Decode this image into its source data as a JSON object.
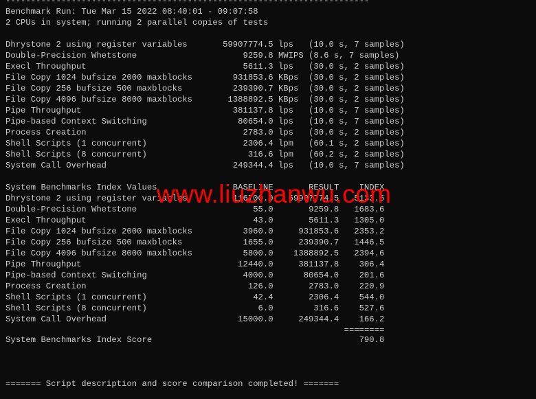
{
  "header": {
    "separator": "------------------------------------------------------------------------",
    "run_line": "Benchmark Run: Tue Mar 15 2022 08:40:01 - 09:07:58",
    "cpu_line": "2 CPUs in system; running 2 parallel copies of tests"
  },
  "results": [
    {
      "name": "Dhrystone 2 using register variables",
      "value": "59907774.5",
      "unit": "lps",
      "detail": "(10.0 s, 7 samples)"
    },
    {
      "name": "Double-Precision Whetstone",
      "value": "9259.8",
      "unit": "MWIPS",
      "detail": "(8.6 s, 7 samples)"
    },
    {
      "name": "Execl Throughput",
      "value": "5611.3",
      "unit": "lps",
      "detail": "(30.0 s, 2 samples)"
    },
    {
      "name": "File Copy 1024 bufsize 2000 maxblocks",
      "value": "931853.6",
      "unit": "KBps",
      "detail": "(30.0 s, 2 samples)"
    },
    {
      "name": "File Copy 256 bufsize 500 maxblocks",
      "value": "239390.7",
      "unit": "KBps",
      "detail": "(30.0 s, 2 samples)"
    },
    {
      "name": "File Copy 4096 bufsize 8000 maxblocks",
      "value": "1388892.5",
      "unit": "KBps",
      "detail": "(30.0 s, 2 samples)"
    },
    {
      "name": "Pipe Throughput",
      "value": "381137.8",
      "unit": "lps",
      "detail": "(10.0 s, 7 samples)"
    },
    {
      "name": "Pipe-based Context Switching",
      "value": "80654.0",
      "unit": "lps",
      "detail": "(10.0 s, 7 samples)"
    },
    {
      "name": "Process Creation",
      "value": "2783.0",
      "unit": "lps",
      "detail": "(30.0 s, 2 samples)"
    },
    {
      "name": "Shell Scripts (1 concurrent)",
      "value": "2306.4",
      "unit": "lpm",
      "detail": "(60.1 s, 2 samples)"
    },
    {
      "name": "Shell Scripts (8 concurrent)",
      "value": "316.6",
      "unit": "lpm",
      "detail": "(60.2 s, 2 samples)"
    },
    {
      "name": "System Call Overhead",
      "value": "249344.4",
      "unit": "lps",
      "detail": "(10.0 s, 7 samples)"
    }
  ],
  "index": {
    "title": "System Benchmarks Index Values",
    "col_baseline": "BASELINE",
    "col_result": "RESULT",
    "col_index": "INDEX",
    "rows": [
      {
        "name": "Dhrystone 2 using register variables",
        "baseline": "116700.0",
        "result": "59907774.5",
        "index": "5133.5"
      },
      {
        "name": "Double-Precision Whetstone",
        "baseline": "55.0",
        "result": "9259.8",
        "index": "1683.6"
      },
      {
        "name": "Execl Throughput",
        "baseline": "43.0",
        "result": "5611.3",
        "index": "1305.0"
      },
      {
        "name": "File Copy 1024 bufsize 2000 maxblocks",
        "baseline": "3960.0",
        "result": "931853.6",
        "index": "2353.2"
      },
      {
        "name": "File Copy 256 bufsize 500 maxblocks",
        "baseline": "1655.0",
        "result": "239390.7",
        "index": "1446.5"
      },
      {
        "name": "File Copy 4096 bufsize 8000 maxblocks",
        "baseline": "5800.0",
        "result": "1388892.5",
        "index": "2394.6"
      },
      {
        "name": "Pipe Throughput",
        "baseline": "12440.0",
        "result": "381137.8",
        "index": "306.4"
      },
      {
        "name": "Pipe-based Context Switching",
        "baseline": "4000.0",
        "result": "80654.0",
        "index": "201.6"
      },
      {
        "name": "Process Creation",
        "baseline": "126.0",
        "result": "2783.0",
        "index": "220.9"
      },
      {
        "name": "Shell Scripts (1 concurrent)",
        "baseline": "42.4",
        "result": "2306.4",
        "index": "544.0"
      },
      {
        "name": "Shell Scripts (8 concurrent)",
        "baseline": "6.0",
        "result": "316.6",
        "index": "527.6"
      },
      {
        "name": "System Call Overhead",
        "baseline": "15000.0",
        "result": "249344.4",
        "index": "166.2"
      }
    ],
    "rule": "========",
    "score_label": "System Benchmarks Index Score",
    "score": "790.8"
  },
  "footer": "======= Script description and score comparison completed! =======",
  "watermark": "www.liuzhanwu.com",
  "colors": {
    "background": "#0c0c0c",
    "text": "#cccccc",
    "watermark": "#ff0000"
  }
}
